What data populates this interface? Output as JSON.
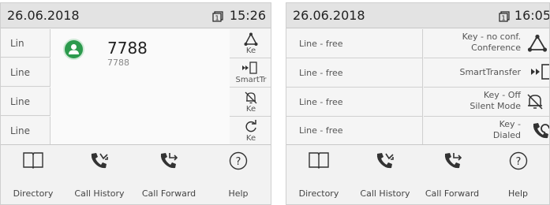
{
  "phone1": {
    "status": {
      "date": "26.06.2018",
      "time": "15:26",
      "line_icon": "line-1-icon"
    },
    "line_keys": [
      "Lin",
      "Line",
      "Line",
      "Line"
    ],
    "call": {
      "name": "7788",
      "number": "7788",
      "avatar_icon": "contact-avatar-icon"
    },
    "right_keys": [
      {
        "label": "Ke",
        "icon": "conference-icon"
      },
      {
        "label": "SmartTr",
        "icon": "smart-transfer-icon"
      },
      {
        "label": "Ke",
        "icon": "silent-mode-icon"
      },
      {
        "label": "Ke",
        "icon": "redial-icon"
      }
    ],
    "softkeys": [
      {
        "label": "Directory",
        "icon": "book-icon"
      },
      {
        "label": "Call History",
        "icon": "call-history-icon"
      },
      {
        "label": "Call Forward",
        "icon": "call-forward-icon"
      },
      {
        "label": "Help",
        "icon": "help-icon"
      }
    ]
  },
  "phone2": {
    "status": {
      "date": "26.06.2018",
      "time": "16:05",
      "line_icon": "line-1-icon"
    },
    "line_keys": [
      "Line - free",
      "Line - free",
      "Line - free",
      "Line - free"
    ],
    "right_keys": [
      {
        "line1": "Key - no conf.",
        "line2": "Conference",
        "icon": "conference-icon"
      },
      {
        "line1": "SmartTransfer",
        "line2": "",
        "icon": "smart-transfer-icon"
      },
      {
        "line1": "Key - Off",
        "line2": "Silent Mode",
        "icon": "silent-mode-icon"
      },
      {
        "line1": "Key -",
        "line2": "Dialed",
        "icon": "redial-icon"
      }
    ],
    "softkeys": [
      {
        "label": "Directory",
        "icon": "book-icon"
      },
      {
        "label": "Call History",
        "icon": "call-history-icon"
      },
      {
        "label": "Call Forward",
        "icon": "call-forward-icon"
      },
      {
        "label": "Help",
        "icon": "help-icon"
      }
    ]
  }
}
